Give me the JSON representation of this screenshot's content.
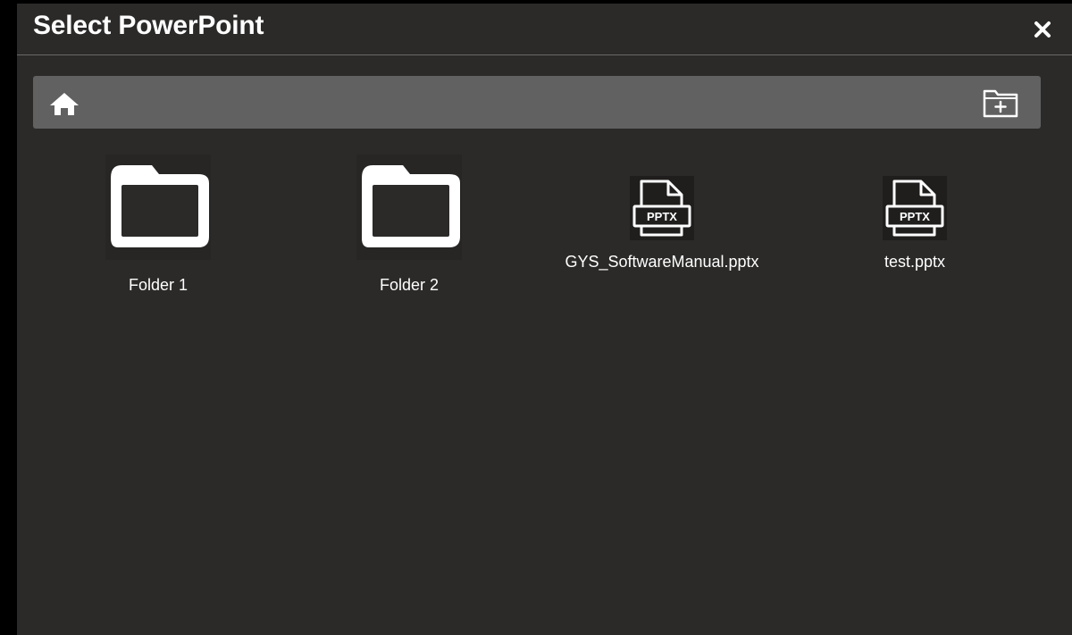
{
  "dialog": {
    "title": "Select PowerPoint",
    "close_icon": "close-icon"
  },
  "toolbar": {
    "home_icon": "home-icon",
    "new_folder_icon": "new-folder-icon"
  },
  "items": [
    {
      "type": "folder",
      "label": "Folder 1",
      "icon": "folder-icon"
    },
    {
      "type": "folder",
      "label": "Folder 2",
      "icon": "folder-icon"
    },
    {
      "type": "file",
      "label": "GYS_SoftwareManual.pptx",
      "icon": "pptx-file-icon",
      "badge": "PPTX"
    },
    {
      "type": "file",
      "label": "test.pptx",
      "icon": "pptx-file-icon",
      "badge": "PPTX"
    }
  ],
  "colors": {
    "background": "#000000",
    "dialog": "#2b2a29",
    "toolbar": "#616161",
    "text": "#ffffff"
  }
}
